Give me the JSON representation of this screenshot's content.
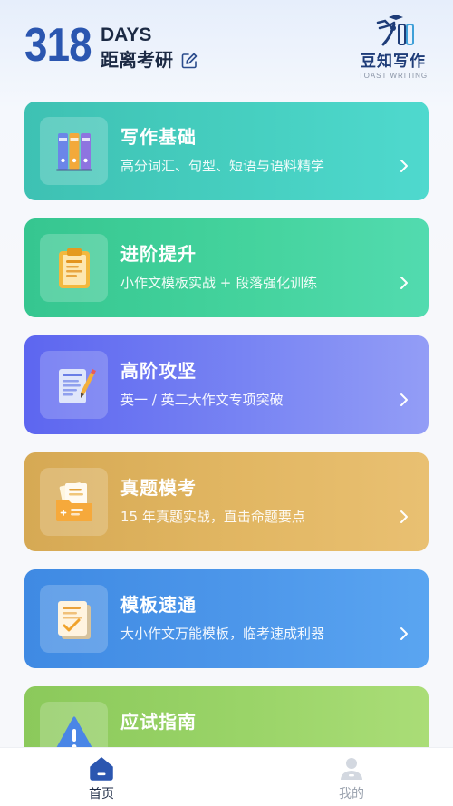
{
  "header": {
    "days_number": "318",
    "days_unit": "DAYS",
    "days_target": "距离考研",
    "edit_icon": "edit-icon",
    "brand_name": "豆知写作",
    "brand_sub": "TOAST WRITING"
  },
  "cards": [
    {
      "title": "写作基础",
      "desc": "高分词汇、句型、短语与语料精学",
      "icon": "binders-icon",
      "color": "#46cfc0"
    },
    {
      "title": "进阶提升",
      "desc": "小作文模板实战 + 段落强化训练",
      "icon": "clipboard-icon",
      "color": "#44d39d"
    },
    {
      "title": "高阶攻坚",
      "desc": "英一 / 英二大作文专项突破",
      "icon": "notepad-pencil-icon",
      "color": "#7884f3"
    },
    {
      "title": "真题模考",
      "desc": "15 年真题实战，直击命题要点",
      "icon": "folder-papers-icon",
      "color": "#e2b763"
    },
    {
      "title": "模板速通",
      "desc": "大小作文万能模板，临考速成利器",
      "icon": "checked-document-icon",
      "color": "#4d97ea"
    },
    {
      "title": "应试指南",
      "desc": "",
      "icon": "warning-icon",
      "color": "#9ad468"
    }
  ],
  "tabbar": {
    "home_label": "首页",
    "me_label": "我的",
    "active_color": "#2b56b0"
  }
}
